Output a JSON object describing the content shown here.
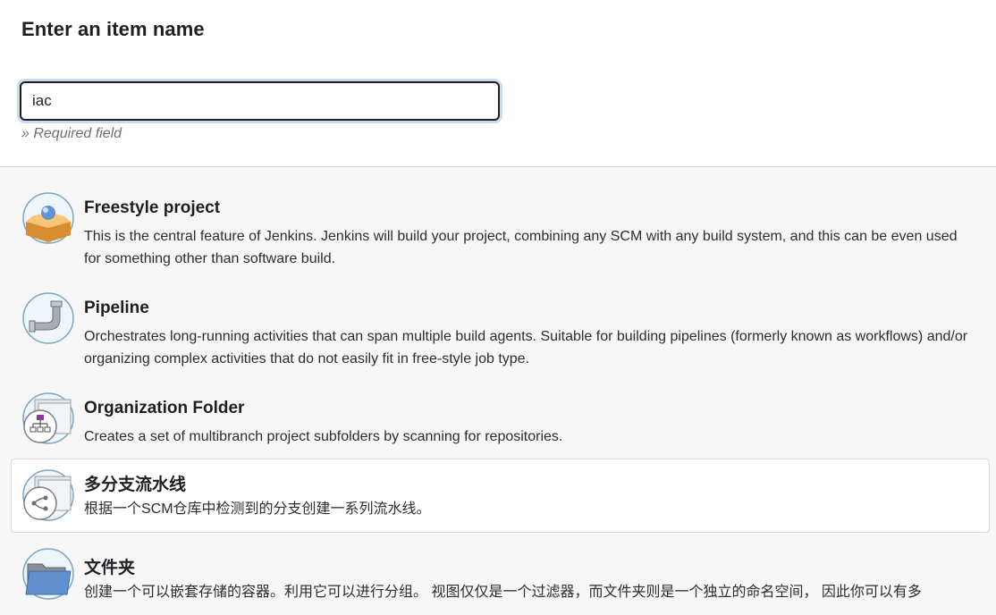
{
  "page": {
    "title": "Enter an item name",
    "name_input_value": "iac",
    "required_hint": "» Required field"
  },
  "items": [
    {
      "title": "Freestyle project",
      "description": "This is the central feature of Jenkins. Jenkins will build your project, combining any SCM with any build system, and this can be even used for something other than software build.",
      "icon": "freestyle-box-icon"
    },
    {
      "title": "Pipeline",
      "description": "Orchestrates long-running activities that can span multiple build agents. Suitable for building pipelines (formerly known as workflows) and/or organizing complex activities that do not easily fit in free-style job type.",
      "icon": "pipeline-pipe-icon"
    },
    {
      "title": "Organization Folder",
      "description": "Creates a set of multibranch project subfolders by scanning for repositories.",
      "icon": "organization-folder-icon"
    },
    {
      "title": "多分支流水线",
      "description": "根据一个SCM仓库中检测到的分支创建一系列流水线。",
      "icon": "multibranch-pipeline-icon",
      "selected": true
    },
    {
      "title": "文件夹",
      "description": "创建一个可以嵌套存储的容器。利用它可以进行分组。 视图仅仅是一个过滤器，而文件夹则是一个独立的命名空间， 因此你可以有多",
      "icon": "folder-icon"
    }
  ],
  "colors": {
    "input_focus_ring": "#c9dcf0",
    "selected_item_bg": "#ffffff",
    "page_bg": "#f7f7f8"
  }
}
